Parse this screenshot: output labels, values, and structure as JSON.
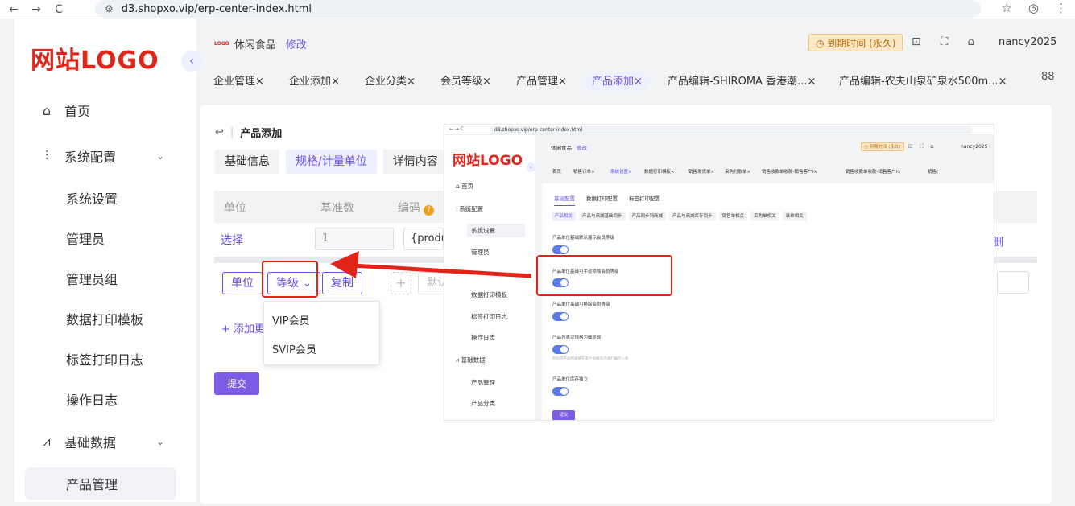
{
  "browser": {
    "url": "d3.shopxo.vip/erp-center-index.html",
    "back_icon": "←",
    "forward_icon": "→",
    "reload_icon": "C",
    "site_icon": "⚙",
    "star_icon": "☆",
    "profile_icon": "◎",
    "menu_icon": "⋮"
  },
  "sidebar": {
    "logo": "网站LOGO",
    "collapse_icon": "‹",
    "items": [
      {
        "label": "首页",
        "icon": "⌂"
      },
      {
        "label": "系统配置",
        "icon": "⫶",
        "chevron": "⌄"
      },
      {
        "label": "系统设置"
      },
      {
        "label": "管理员"
      },
      {
        "label": "管理员组"
      },
      {
        "label": "数据打印模板"
      },
      {
        "label": "标签打印日志"
      },
      {
        "label": "操作日志"
      },
      {
        "label": "基础数据",
        "icon": "⩘",
        "chevron": "⌄"
      },
      {
        "label": "产品管理"
      }
    ]
  },
  "header": {
    "store_name": "休闲食品",
    "edit_label": "修改",
    "expire_label": "◷ 到期时间 (永久)",
    "icons": [
      "⊡",
      "⛶",
      "⌂"
    ],
    "user": "nancy2025"
  },
  "tabs": {
    "items": [
      "企业管理×",
      "企业添加×",
      "企业分类×",
      "会员等级×",
      "产品管理×",
      "产品添加×",
      "产品编辑-SHIROMA 香港潮...×",
      "产品编辑-农夫山泉矿泉水500m...×"
    ],
    "more_icon": "88"
  },
  "page": {
    "back_icon": "↩",
    "title": "产品添加",
    "subtabs": [
      "基础信息",
      "规格/计量单位",
      "详情内容"
    ],
    "columns": [
      "单位",
      "基准数",
      "编码"
    ],
    "help_icon": "?",
    "row": {
      "link": "选择",
      "base": "1",
      "code": "{product"
    },
    "right_link": "删",
    "buttons": {
      "unit": "单位",
      "level": "等级 ⌄",
      "copy": "复制"
    },
    "plus": "+",
    "default_placeholder": "默认",
    "add_more": "+ 添加更",
    "submit": "提交",
    "dropdown": [
      "VIP会员",
      "SVIP会员"
    ]
  },
  "inset": {
    "url": "d3.shopxo.vip/erp-center-index.html",
    "logo": "网站LOGO",
    "store": "休闲食品",
    "edit": "修改",
    "expire": "◷ 到期时间 (永久)",
    "user": "nancy2025",
    "menu": [
      "首页",
      "系统配置",
      "基础数据"
    ],
    "sub": [
      "系统设置",
      "管理员",
      "数据打印模板",
      "标签打印日志",
      "操作日志",
      "产品管理",
      "产品分类"
    ],
    "tabs": [
      "首页",
      "销售订单×",
      "系统设置×",
      "数据打印模板×",
      "销售发货单×",
      "采购付款单×",
      "销售收款单收款-销售客户I×",
      "销售收款单收款-销售客户I×",
      "销售("
    ],
    "cfg_tabs": [
      "基础配置",
      "数据打印配置",
      "标签打印配置"
    ],
    "chips": [
      "产品相关",
      "产品与商城基础同步",
      "产品同步到商城",
      "产品与商城库存同步",
      "销售单相关",
      "采购单相关",
      "录单相关"
    ],
    "settings": [
      {
        "label": "产品单位基础默认展示会员等级"
      },
      {
        "label": "产品单位基础可手动添加会员等级"
      },
      {
        "label": "产品单位基础可移除会员等级"
      },
      {
        "label": "产品列表以规格为细显现",
        "note": "开启后产品列表将在多个规格的产品们展示一条"
      },
      {
        "label": "产品单位库存独立"
      }
    ],
    "submit": "提交"
  }
}
